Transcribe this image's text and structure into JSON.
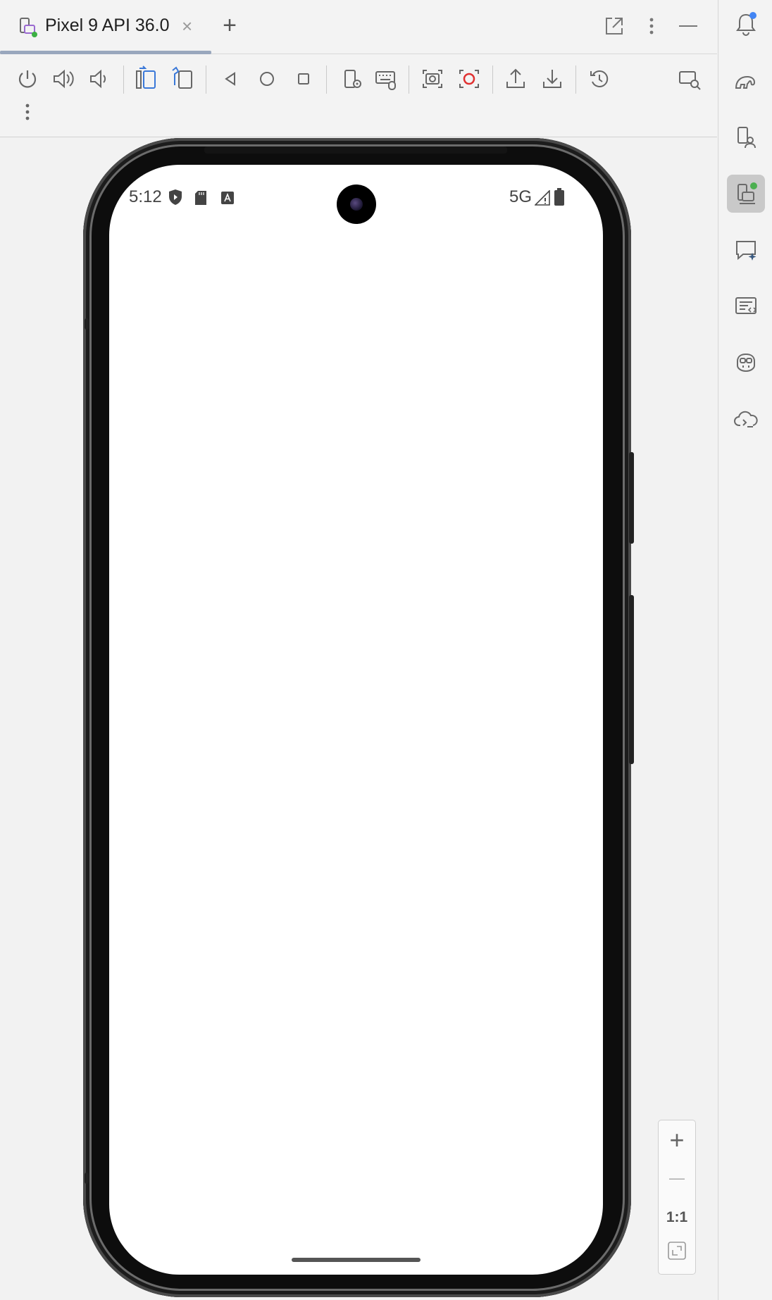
{
  "tab": {
    "title": "Pixel 9 API 36.0",
    "close_glyph": "×",
    "new_tab_glyph": "+"
  },
  "window_controls": [
    "open-in-window-icon",
    "more-vert-icon",
    "minimize-icon"
  ],
  "toolbar": {
    "buttons": [
      "power-icon",
      "volume-up-icon",
      "volume-down-icon",
      "rotate-left-icon",
      "rotate-right-icon",
      "back-icon",
      "home-icon",
      "overview-icon",
      "device-settings-icon",
      "keyboard-icon",
      "screenshot-icon",
      "screen-record-icon",
      "export-icon",
      "import-icon",
      "snapshot-restore-icon",
      "device-zoom-search-icon",
      "more-vert-icon"
    ]
  },
  "device": {
    "status_time": "5:12",
    "status_network": "5G",
    "status_icons": [
      "shield-icon",
      "sd-card-icon",
      "font-a-icon",
      "signal-icon",
      "battery-icon"
    ]
  },
  "zoom": {
    "plus": "+",
    "minus": "—",
    "ratio": "1:1"
  },
  "rightbar": {
    "icons": [
      "notifications-icon",
      "gradle-elephant-icon",
      "device-manager-icon",
      "running-devices-icon",
      "gemini-chat-icon",
      "logcat-icon",
      "copilot-icon",
      "cloud-terminal-icon"
    ],
    "active": "running-devices-icon",
    "badges": {
      "notifications": "#4285f4",
      "running_devices": "#4caf50"
    }
  },
  "colors": {
    "accent_blue": "#3a78d8",
    "record_red": "#e03030",
    "tab_underline": "#99a7bd"
  }
}
